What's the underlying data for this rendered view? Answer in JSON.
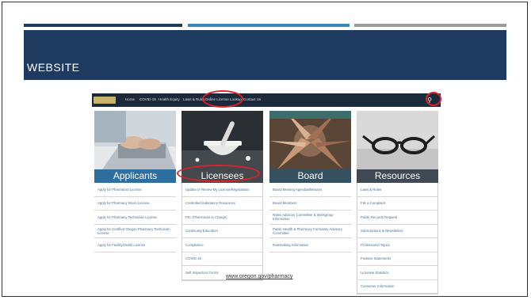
{
  "slide": {
    "title": "WEBSITE",
    "url": "www.oregon.gov/pharmacy"
  },
  "nav": {
    "items": [
      "Home",
      "COVID-19",
      "Health Equity",
      "Laws & Rules",
      "Online License Lookup",
      "Contact Us"
    ]
  },
  "columns": [
    {
      "title": "Applicants",
      "links": [
        "Apply for Pharmacist License",
        "Apply for Pharmacy Intern License",
        "Apply for Pharmacy Technician License",
        "Apply for Certified Oregon Pharmacy Technician License",
        "Apply for Facility/Outlet License"
      ]
    },
    {
      "title": "Licensees",
      "links": [
        "Update or Renew My License/Registration",
        "Controlled Substance Resources",
        "PIC (Pharmacist in Charge)",
        "Continuing Education",
        "Compliance",
        "COVID-19",
        "Self Inspection Forms"
      ]
    },
    {
      "title": "Board",
      "links": [
        "Board Meeting Agendas/Minutes",
        "Board Members",
        "Rules Advisory Committee & Workgroup Information",
        "Public Health & Pharmacy Formulary Advisory Committee",
        "Rulemaking Information"
      ]
    },
    {
      "title": "Resources",
      "links": [
        "Laws & Rules",
        "File a Complaint",
        "Public Records Request",
        "Subscriptions & Newsletters",
        "Professional Topics",
        "Position Statements",
        "Licensee Statistics",
        "Consumer Information"
      ]
    }
  ],
  "colors": {
    "banner": "#1e3a5f",
    "accent_blue": "#3a86b8",
    "accent_gray": "#9a9a9a",
    "title_band": "#1e3a5f",
    "highlight": "#e0202a"
  }
}
